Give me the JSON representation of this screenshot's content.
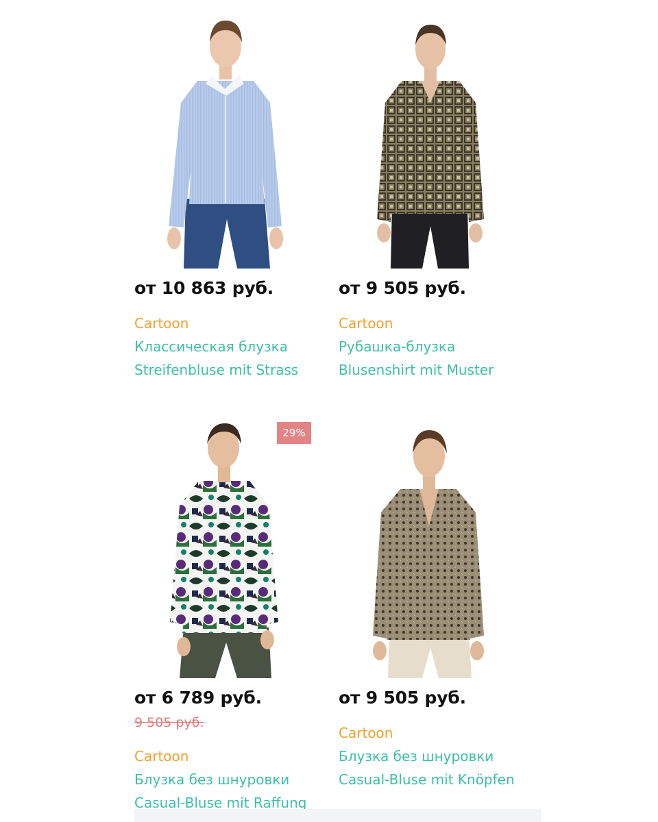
{
  "products": [
    {
      "price": "от 10 863 руб.",
      "brand": "Cartoon",
      "name_ru": "Классическая блузка",
      "name_de": "Streifenbluse mit Strass"
    },
    {
      "price": "от 9 505 руб.",
      "brand": "Cartoon",
      "name_ru": "Рубашка-блузка",
      "name_de": "Blusenshirt mit Muster"
    },
    {
      "price": "от 6 789 руб.",
      "old_price": "9 505 руб.",
      "discount": "29%",
      "brand": "Cartoon",
      "name_ru": "Блузка без шнуровки",
      "name_de": "Casual-Bluse mit Raffung"
    },
    {
      "price": "от 9 505 руб.",
      "brand": "Cartoon",
      "name_ru": "Блузка без шнуровки",
      "name_de": "Casual-Bluse mit Knöpfen"
    }
  ],
  "colors": {
    "price": "#111111",
    "brand": "#f0a02c",
    "name": "#3cbfa8",
    "discount_bg": "#e28384",
    "old_price": "#e07a7a"
  }
}
